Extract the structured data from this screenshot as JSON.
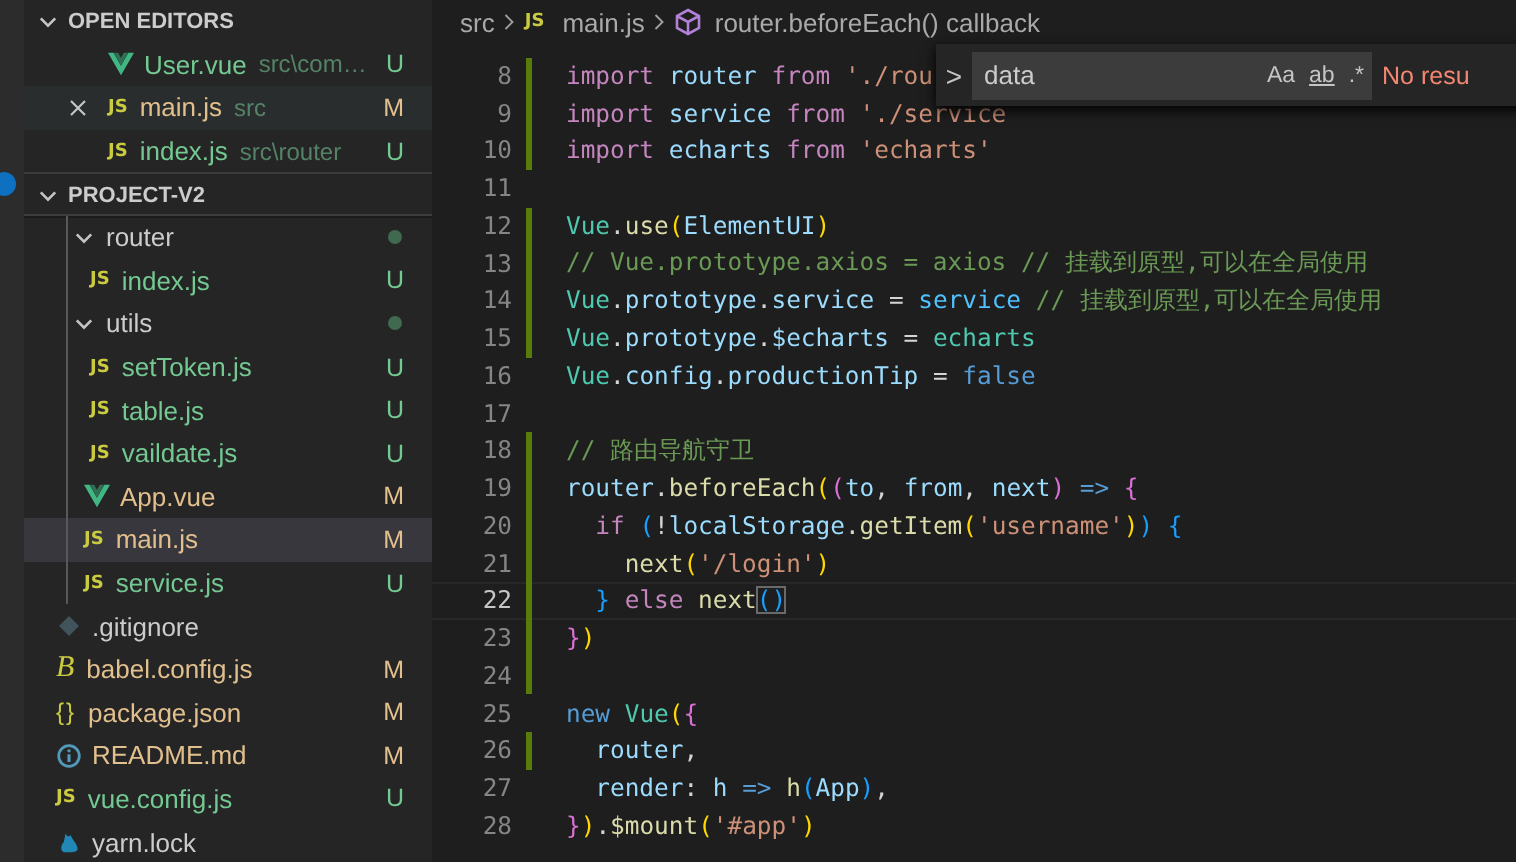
{
  "activity_bar": {
    "badge": true
  },
  "open_editors": {
    "title": "OPEN EDITORS",
    "expanded": true,
    "items": [
      {
        "kind": "vue",
        "name": "User.vue",
        "path": "src\\com…",
        "status": "U",
        "selected": false
      },
      {
        "kind": "js",
        "icon_label": "JS",
        "name": "main.js",
        "path": "src",
        "status": "M",
        "selected": true
      },
      {
        "kind": "js",
        "icon_label": "JS",
        "name": "index.js",
        "path": "src\\router",
        "status": "U",
        "selected": false
      }
    ]
  },
  "project": {
    "title": "PROJECT-V2",
    "expanded": true,
    "src_items": [
      {
        "kind": "folder",
        "name": "router",
        "has_changes": true,
        "expanded": true,
        "selected": false,
        "children": [
          {
            "kind": "js",
            "icon_label": "JS",
            "name": "index.js",
            "status": "U",
            "selected": false
          }
        ]
      },
      {
        "kind": "folder",
        "name": "utils",
        "has_changes": true,
        "expanded": true,
        "selected": false,
        "children": [
          {
            "kind": "js",
            "icon_label": "JS",
            "name": "setToken.js",
            "status": "U",
            "selected": false
          },
          {
            "kind": "js",
            "icon_label": "JS",
            "name": "table.js",
            "status": "U",
            "selected": false
          },
          {
            "kind": "js",
            "icon_label": "JS",
            "name": "vaildate.js",
            "status": "U",
            "selected": false
          }
        ]
      },
      {
        "kind": "vue",
        "name": "App.vue",
        "status": "M",
        "selected": false
      },
      {
        "kind": "js",
        "icon_label": "JS",
        "name": "main.js",
        "status": "M",
        "selected": true
      },
      {
        "kind": "js",
        "icon_label": "JS",
        "name": "service.js",
        "status": "U",
        "selected": false
      }
    ],
    "root_items": [
      {
        "kind": "git",
        "name": ".gitignore",
        "selected": false
      },
      {
        "kind": "babel",
        "icon_label": "B",
        "name": "babel.config.js",
        "status": "M",
        "selected": false
      },
      {
        "kind": "json",
        "icon_label": "{}",
        "name": "package.json",
        "status": "M",
        "selected": false
      },
      {
        "kind": "info",
        "name": "README.md",
        "status": "M",
        "selected": false
      },
      {
        "kind": "js",
        "icon_label": "JS",
        "name": "vue.config.js",
        "status": "U",
        "selected": false
      },
      {
        "kind": "yarn",
        "name": "yarn.lock",
        "selected": false
      }
    ]
  },
  "breadcrumbs": [
    {
      "kind": "folder",
      "text": "src"
    },
    {
      "kind": "js",
      "icon_label": "JS",
      "text": "main.js"
    },
    {
      "kind": "symbol",
      "text": "router.beforeEach() callback"
    }
  ],
  "find": {
    "expanded": false,
    "toggle": ">",
    "value": "data",
    "options": [
      {
        "label": "Aa",
        "on": false
      },
      {
        "label": "ab",
        "on": false
      },
      {
        "label": ".*",
        "on": false
      }
    ],
    "message": "No resu"
  },
  "lines": [
    {
      "number": "8",
      "changed": true,
      "current": false,
      "tokens": [
        {
          "kind": "kw",
          "text": "import "
        },
        {
          "kind": "var",
          "text": "router "
        },
        {
          "kind": "kw",
          "text": "from "
        },
        {
          "kind": "str",
          "text": "'./rou"
        }
      ]
    },
    {
      "number": "9",
      "changed": true,
      "current": false,
      "tokens": [
        {
          "kind": "kw",
          "text": "import "
        },
        {
          "kind": "var",
          "text": "service "
        },
        {
          "kind": "kw",
          "text": "from "
        },
        {
          "kind": "str",
          "text": "'./service"
        }
      ]
    },
    {
      "number": "10",
      "changed": true,
      "current": false,
      "tokens": [
        {
          "kind": "kw",
          "text": "import "
        },
        {
          "kind": "var",
          "text": "echarts "
        },
        {
          "kind": "kw",
          "text": "from "
        },
        {
          "kind": "str",
          "text": "'echarts'"
        }
      ]
    },
    {
      "number": "11",
      "changed": false,
      "current": false
    },
    {
      "number": "12",
      "changed": true,
      "current": false,
      "tokens": [
        {
          "kind": "class",
          "text": "Vue"
        },
        {
          "kind": "plain",
          "text": "."
        },
        {
          "kind": "fn",
          "text": "use"
        },
        {
          "kind": "b1",
          "text": "("
        },
        {
          "kind": "var",
          "text": "ElementUI"
        },
        {
          "kind": "b1",
          "text": ")"
        }
      ]
    },
    {
      "number": "13",
      "changed": true,
      "current": false,
      "tokens": [
        {
          "kind": "comment",
          "text": "// Vue.prototype.axios = axios // 挂载到原型,可以在全局使用"
        }
      ]
    },
    {
      "number": "14",
      "changed": true,
      "current": false,
      "tokens": [
        {
          "kind": "class",
          "text": "Vue"
        },
        {
          "kind": "plain",
          "text": "."
        },
        {
          "kind": "var",
          "text": "prototype"
        },
        {
          "kind": "plain",
          "text": "."
        },
        {
          "kind": "var",
          "text": "service"
        },
        {
          "kind": "plain",
          "text": " = "
        },
        {
          "kind": "const",
          "text": "service"
        },
        {
          "kind": "comment",
          "text": " // 挂载到原型,可以在全局使用"
        }
      ]
    },
    {
      "number": "15",
      "changed": true,
      "current": false,
      "tokens": [
        {
          "kind": "class",
          "text": "Vue"
        },
        {
          "kind": "plain",
          "text": "."
        },
        {
          "kind": "var",
          "text": "prototype"
        },
        {
          "kind": "plain",
          "text": "."
        },
        {
          "kind": "var",
          "text": "$echarts"
        },
        {
          "kind": "plain",
          "text": " = "
        },
        {
          "kind": "class",
          "text": "echarts"
        }
      ]
    },
    {
      "number": "16",
      "changed": false,
      "current": false,
      "tokens": [
        {
          "kind": "class",
          "text": "Vue"
        },
        {
          "kind": "plain",
          "text": "."
        },
        {
          "kind": "var",
          "text": "config"
        },
        {
          "kind": "plain",
          "text": "."
        },
        {
          "kind": "var",
          "text": "productionTip"
        },
        {
          "kind": "plain",
          "text": " = "
        },
        {
          "kind": "blue",
          "text": "false"
        }
      ]
    },
    {
      "number": "17",
      "changed": false,
      "current": false
    },
    {
      "number": "18",
      "changed": true,
      "current": false,
      "tokens": [
        {
          "kind": "comment",
          "text": "// 路由导航守卫"
        }
      ]
    },
    {
      "number": "19",
      "changed": true,
      "current": false,
      "tokens": [
        {
          "kind": "var",
          "text": "router"
        },
        {
          "kind": "plain",
          "text": "."
        },
        {
          "kind": "fn",
          "text": "beforeEach"
        },
        {
          "kind": "b1",
          "text": "("
        },
        {
          "kind": "b2",
          "text": "("
        },
        {
          "kind": "var",
          "text": "to"
        },
        {
          "kind": "plain",
          "text": ", "
        },
        {
          "kind": "var",
          "text": "from"
        },
        {
          "kind": "plain",
          "text": ", "
        },
        {
          "kind": "var",
          "text": "next"
        },
        {
          "kind": "b2",
          "text": ")"
        },
        {
          "kind": "blue",
          "text": " => "
        },
        {
          "kind": "b2",
          "text": "{"
        }
      ]
    },
    {
      "number": "20",
      "changed": true,
      "current": false,
      "tokens": [
        {
          "kind": "kw",
          "text": "  if "
        },
        {
          "kind": "b3",
          "text": "("
        },
        {
          "kind": "plain",
          "text": "!"
        },
        {
          "kind": "var",
          "text": "localStorage"
        },
        {
          "kind": "plain",
          "text": "."
        },
        {
          "kind": "fn",
          "text": "getItem"
        },
        {
          "kind": "b1",
          "text": "("
        },
        {
          "kind": "str",
          "text": "'username'"
        },
        {
          "kind": "b1",
          "text": ")"
        },
        {
          "kind": "b3",
          "text": ")"
        },
        {
          "kind": "b3",
          "text": " {"
        }
      ]
    },
    {
      "number": "21",
      "changed": true,
      "current": false,
      "tokens": [
        {
          "kind": "fn",
          "text": "    next"
        },
        {
          "kind": "b1",
          "text": "("
        },
        {
          "kind": "str",
          "text": "'/login'"
        },
        {
          "kind": "b1",
          "text": ")"
        }
      ]
    },
    {
      "number": "22",
      "changed": true,
      "current": true,
      "tokens": [
        {
          "kind": "b3",
          "text": "  } "
        },
        {
          "kind": "kw",
          "text": "else "
        },
        {
          "kind": "fn",
          "text": "next"
        },
        {
          "kind": "match",
          "text": "()"
        }
      ]
    },
    {
      "number": "23",
      "changed": true,
      "current": false,
      "tokens": [
        {
          "kind": "b2",
          "text": "}"
        },
        {
          "kind": "b1",
          "text": ")"
        }
      ]
    },
    {
      "number": "24",
      "changed": true,
      "current": false
    },
    {
      "number": "25",
      "changed": false,
      "current": false,
      "tokens": [
        {
          "kind": "blue",
          "text": "new "
        },
        {
          "kind": "class",
          "text": "Vue"
        },
        {
          "kind": "b1",
          "text": "("
        },
        {
          "kind": "b2",
          "text": "{"
        }
      ]
    },
    {
      "number": "26",
      "changed": true,
      "current": false,
      "tokens": [
        {
          "kind": "var",
          "text": "  router"
        },
        {
          "kind": "plain",
          "text": ","
        }
      ]
    },
    {
      "number": "27",
      "changed": false,
      "current": false,
      "tokens": [
        {
          "kind": "var",
          "text": "  render"
        },
        {
          "kind": "plain",
          "text": ": "
        },
        {
          "kind": "var",
          "text": "h "
        },
        {
          "kind": "blue",
          "text": "=> "
        },
        {
          "kind": "fn",
          "text": "h"
        },
        {
          "kind": "b3",
          "text": "("
        },
        {
          "kind": "var",
          "text": "App"
        },
        {
          "kind": "b3",
          "text": ")"
        },
        {
          "kind": "plain",
          "text": ","
        }
      ]
    },
    {
      "number": "28",
      "changed": false,
      "current": false,
      "tokens": [
        {
          "kind": "b2",
          "text": "}"
        },
        {
          "kind": "b1",
          "text": ")"
        },
        {
          "kind": "plain",
          "text": "."
        },
        {
          "kind": "fn",
          "text": "$mount"
        },
        {
          "kind": "b1",
          "text": "("
        },
        {
          "kind": "str",
          "text": "'#app'"
        },
        {
          "kind": "b1",
          "text": ")"
        }
      ]
    }
  ]
}
